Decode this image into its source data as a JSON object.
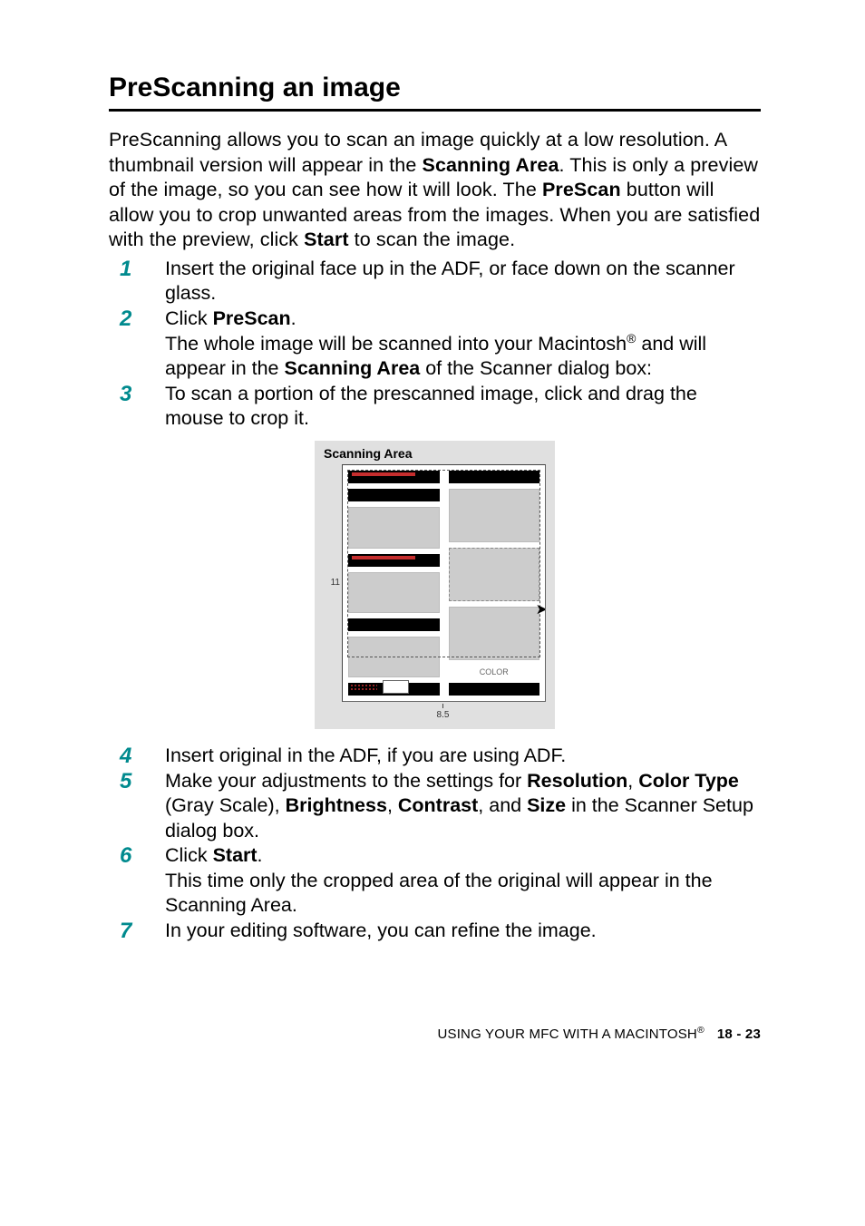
{
  "heading": "PreScanning an image",
  "intro": {
    "prefix1": "PreScanning allows you to scan an image quickly at a low resolution. A thumbnail version will appear in the ",
    "scanning_area": "Scanning Area",
    "mid1": ". This is only a preview of the image, so you can see how it will look. The ",
    "prescan": "PreScan",
    "mid2": " button will allow you to crop unwanted areas from the images. When you are satisfied with the preview, click ",
    "start": "Start",
    "suffix": " to scan the image."
  },
  "steps": {
    "s1": {
      "num": "1",
      "text": "Insert the original face up in the ADF, or face down on the scanner glass."
    },
    "s2": {
      "num": "2",
      "l1a": "Click ",
      "l1b": "PreScan",
      "l1c": ".",
      "l2a": "The whole image will be scanned into your Macintosh",
      "l2sup": "®",
      "l2b": " and will appear in the ",
      "l2c": "Scanning Area",
      "l2d": " of the Scanner dialog box:"
    },
    "s3": {
      "num": "3",
      "text": "To scan a portion of the prescanned image, click and drag the mouse to crop it."
    },
    "s4": {
      "num": "4",
      "text": "Insert original in the ADF, if you are using ADF."
    },
    "s5": {
      "num": "5",
      "a": "Make your adjustments to the settings for ",
      "res": "Resolution",
      "b": ", ",
      "ct": "Color Type",
      "c": " (Gray Scale), ",
      "br": "Brightness",
      "d": ", ",
      "co": "Contrast",
      "e": ", and ",
      "sz": "Size",
      "f": " in the Scanner Setup dialog box."
    },
    "s6": {
      "num": "6",
      "a": "Click ",
      "b": "Start",
      "c": ".",
      "l2": "This time only the cropped area of the original will appear in the Scanning Area."
    },
    "s7": {
      "num": "7",
      "text": "In your editing software, you can refine the image."
    }
  },
  "figure": {
    "title": "Scanning Area",
    "yaxis": "11",
    "xaxis": "8.5",
    "color_label": "COLOR"
  },
  "footer": {
    "text": "USING YOUR MFC WITH A MACINTOSH",
    "sup": "®",
    "page": "18 - 23"
  }
}
